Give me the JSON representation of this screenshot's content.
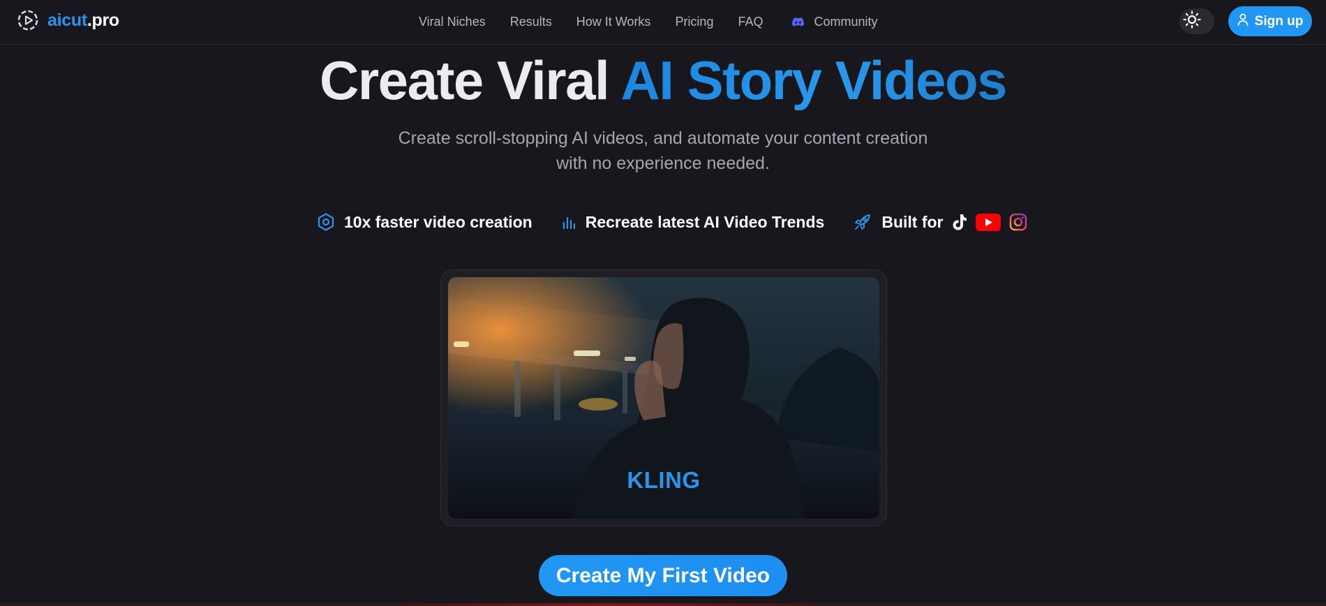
{
  "brand": {
    "name_accent": "aicut",
    "name_rest": ".pro",
    "accent_color": "#2b95ee"
  },
  "nav": {
    "items": [
      {
        "label": "Viral Niches"
      },
      {
        "label": "Results"
      },
      {
        "label": "How It Works"
      },
      {
        "label": "Pricing"
      },
      {
        "label": "FAQ"
      }
    ],
    "community_label": "Community"
  },
  "header": {
    "signup_label": "Sign up",
    "theme_icon": "sun-icon"
  },
  "hero": {
    "title_plain": "Create Viral ",
    "title_gradient": "AI Story Videos",
    "subtitle_line1": "Create scroll-stopping AI videos, and automate your content creation",
    "subtitle_line2": "with no experience needed."
  },
  "features": [
    {
      "label": "10x faster video creation",
      "icon": "hexagon-icon"
    },
    {
      "label": "Recreate latest AI Video Trends",
      "icon": "bar-chart-icon"
    },
    {
      "label": "Built for",
      "icon": "rocket-icon",
      "platforms": [
        "tiktok-icon",
        "youtube-icon",
        "instagram-icon"
      ]
    }
  ],
  "video": {
    "caption": "KLING"
  },
  "cta": {
    "label": "Create My First Video"
  },
  "colors": {
    "background": "#18171d",
    "primary": "#2196f3",
    "muted_text": "#a7a6ae"
  }
}
